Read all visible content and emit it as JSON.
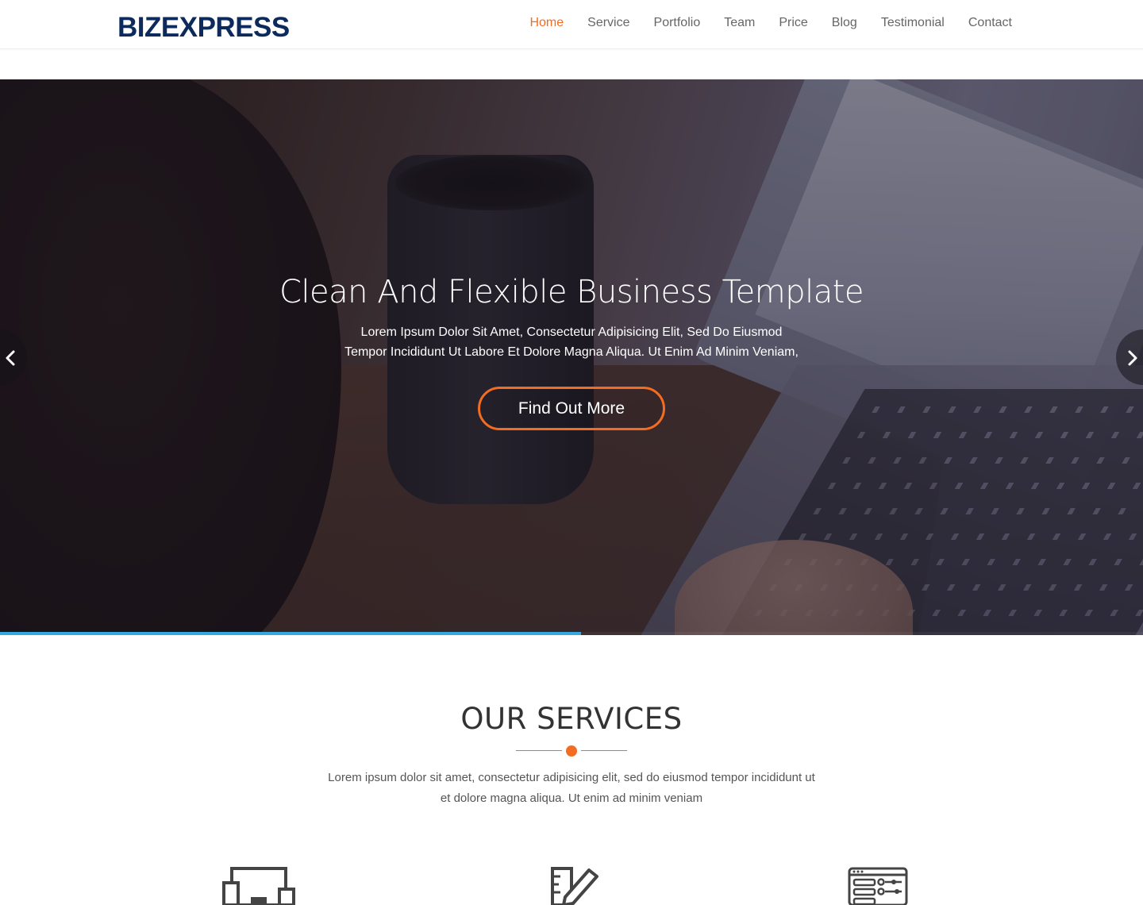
{
  "brand": {
    "logo": "BIZEXPRESS"
  },
  "nav": {
    "items": [
      {
        "label": "Home",
        "active": true
      },
      {
        "label": "Service"
      },
      {
        "label": "Portfolio"
      },
      {
        "label": "Team"
      },
      {
        "label": "Price"
      },
      {
        "label": "Blog"
      },
      {
        "label": "Testimonial"
      },
      {
        "label": "Contact"
      }
    ]
  },
  "hero": {
    "title": "Clean And Flexible Business Template",
    "subtitle_line1": "Lorem Ipsum Dolor Sit Amet, Consectetur Adipisicing Elit, Sed Do Eiusmod",
    "subtitle_line2": "Tempor Incididunt Ut Labore Et Dolore Magna Aliqua. Ut Enim Ad Minim Veniam,",
    "button_label": "Find Out More",
    "prev_icon": "chevron-left-icon",
    "next_icon": "chevron-right-icon",
    "slide_progress": 0.508
  },
  "services": {
    "title": "OUR SERVICES",
    "desc_line1": "Lorem ipsum dolor sit amet, consectetur adipisicing elit, sed do eiusmod tempor incididunt ut",
    "desc_line2": "et dolore magna aliqua. Ut enim ad minim veniam",
    "icons": [
      "devices-icon",
      "design-pencil-icon",
      "settings-panel-icon"
    ]
  },
  "colors": {
    "brand": "#0c2a5c",
    "accent": "#f26d21",
    "progress": "#35a9df",
    "text": "#333333"
  }
}
